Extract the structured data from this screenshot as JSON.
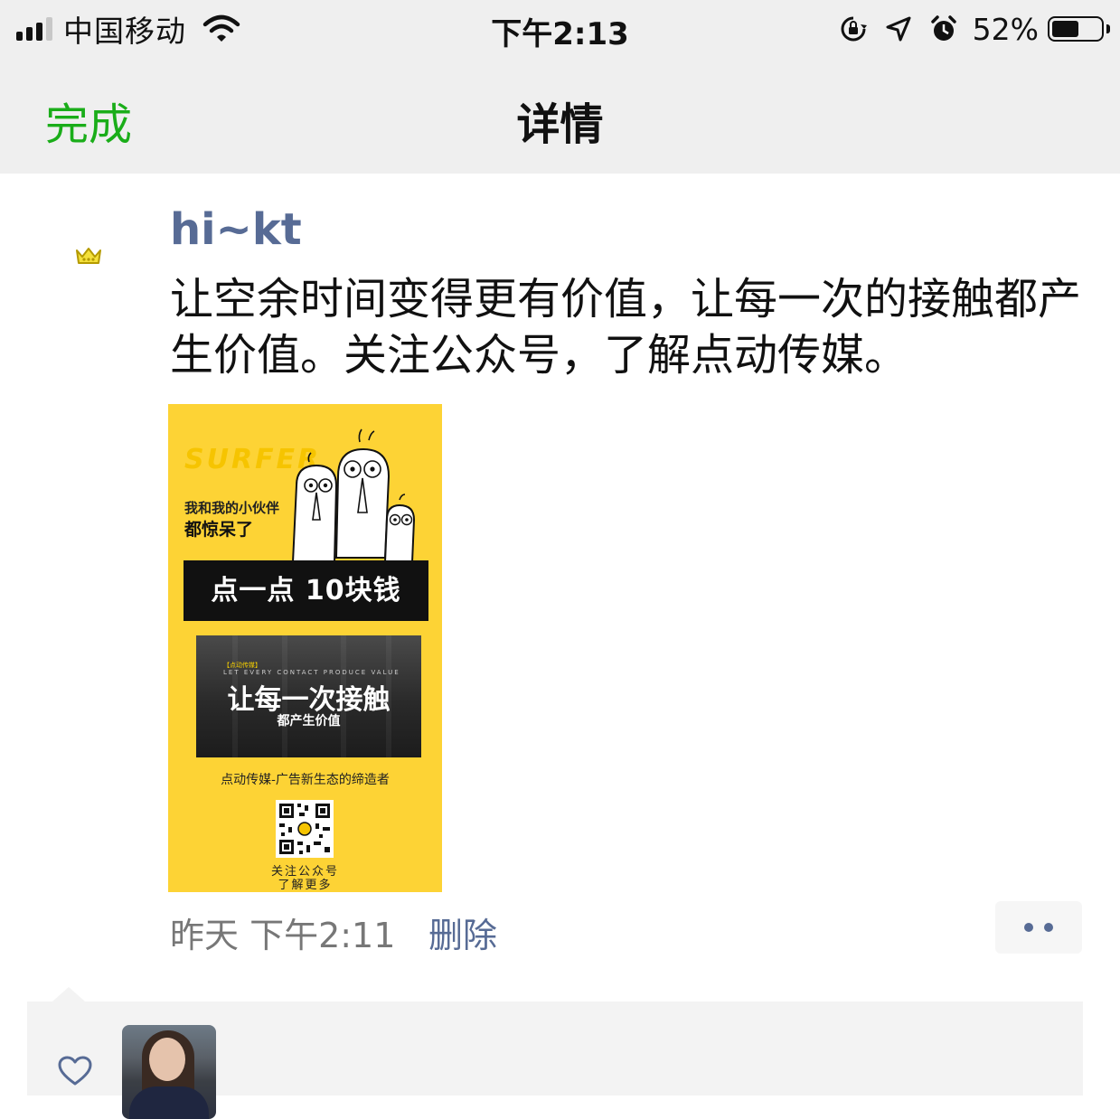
{
  "status_bar": {
    "carrier": "中国移动",
    "time": "下午2:13",
    "battery_percent": "52%",
    "battery_level": 0.52,
    "icons": [
      "signal-icon",
      "wifi-icon",
      "orientation-lock-icon",
      "location-icon",
      "alarm-icon",
      "battery-icon"
    ]
  },
  "nav": {
    "done_label": "完成",
    "title": "详情"
  },
  "post": {
    "author": "hi~kt",
    "text": "让空余时间变得更有价值，让每一次的接触都产生价值。关注公众号，了解点动传媒。",
    "poster": {
      "watermark": "SURFER",
      "line1": "我和我的小伙伴",
      "line2": "都惊呆了",
      "banner": "点一点 10块钱",
      "photo_tag": "【点动传媒】",
      "photo_english": "LET EVERY CONTACT PRODUCE VALUE",
      "photo_title": "让每一次接触",
      "photo_subtitle": "都产生价值",
      "slogan": "点动传媒-广告新生态的缔造者",
      "caption1": "关注公众号",
      "caption2": "了解更多",
      "background_color": "#fdd335"
    },
    "timestamp": "昨天 下午2:11",
    "delete_label": "删除"
  },
  "colors": {
    "accent_green": "#1aad19",
    "link_blue": "#576b95"
  }
}
